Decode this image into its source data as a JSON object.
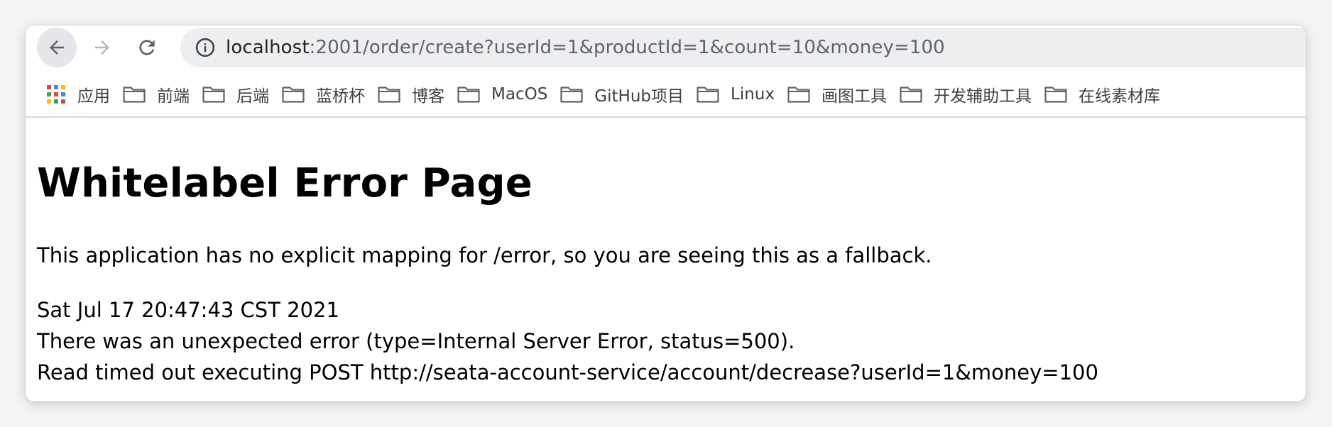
{
  "browser": {
    "url_host": "localhost",
    "url_rest": ":2001/order/create?userId=1&productId=1&count=10&money=100",
    "back_icon": "arrow-left-icon",
    "forward_icon": "arrow-right-icon",
    "reload_icon": "reload-icon",
    "site_info_icon": "info-circle-icon"
  },
  "bookmarks": [
    {
      "label": "应用",
      "icon": "apps-grid-icon"
    },
    {
      "label": "前端",
      "icon": "folder-icon"
    },
    {
      "label": "后端",
      "icon": "folder-icon"
    },
    {
      "label": "蓝桥杯",
      "icon": "folder-icon"
    },
    {
      "label": "博客",
      "icon": "folder-icon"
    },
    {
      "label": "MacOS",
      "icon": "folder-icon"
    },
    {
      "label": "GitHub项目",
      "icon": "folder-icon"
    },
    {
      "label": "Linux",
      "icon": "folder-icon"
    },
    {
      "label": "画图工具",
      "icon": "folder-icon"
    },
    {
      "label": "开发辅助工具",
      "icon": "folder-icon"
    },
    {
      "label": "在线素材库",
      "icon": "folder-icon"
    }
  ],
  "page": {
    "title": "Whitelabel Error Page",
    "message": "This application has no explicit mapping for /error, so you are seeing this as a fallback.",
    "timestamp": "Sat Jul 17 20:47:43 CST 2021",
    "error_line": "There was an unexpected error (type=Internal Server Error, status=500).",
    "detail_line": "Read timed out executing POST http://seata-account-service/account/decrease?userId=1&money=100"
  }
}
